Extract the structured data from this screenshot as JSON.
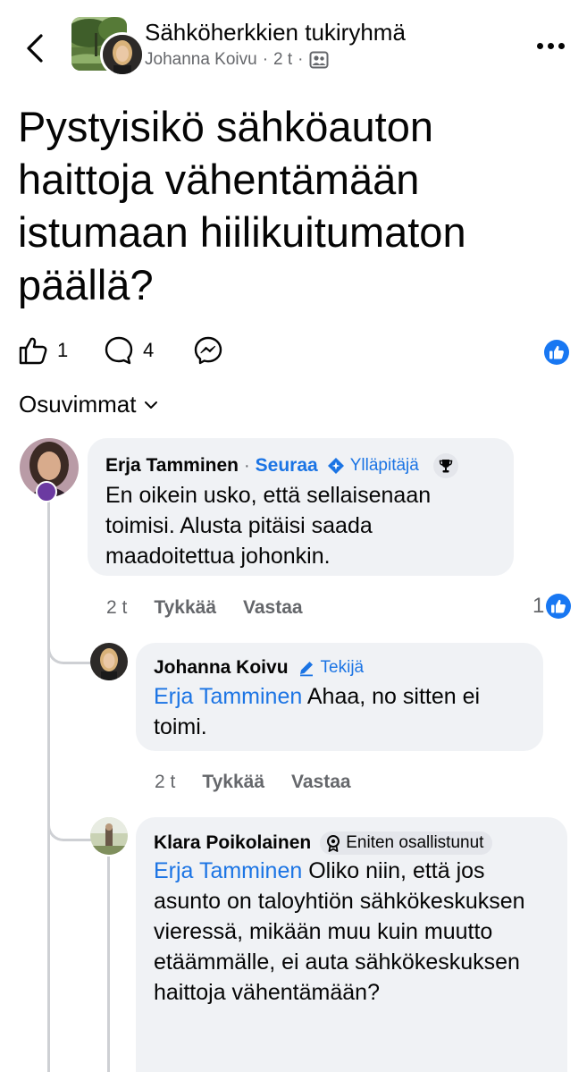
{
  "header": {
    "group_name": "Sähköherkkien tukiryhmä",
    "author": "Johanna Koivu",
    "separator": "·",
    "time": "2 t",
    "audience_icon": "members-icon",
    "back_icon": "chevron-left-icon",
    "more_icon": "more-dots-icon"
  },
  "post": {
    "title": "Pystyisikö sähköauton haittoja vähentämään istumaan hiilikuitumaton päällä?"
  },
  "actions": {
    "like_count": "1",
    "comment_count": "4",
    "share_icon": "messenger-icon",
    "like_badge_icon": "thumbs-up-icon"
  },
  "sort": {
    "label": "Osuvimmat"
  },
  "comments": [
    {
      "name": "Erja Tamminen",
      "separator": "·",
      "follow": "Seuraa",
      "role": "Ylläpitäjä",
      "text": "En oikein usko, että sellaisenaan toimisi. Alusta pitäisi saada maadoitettua johonkin.",
      "time": "2 t",
      "like_label": "Tykkää",
      "reply_label": "Vastaa",
      "reactions": "1"
    },
    {
      "name": "Johanna Koivu",
      "role": "Tekijä",
      "mention": "Erja Tamminen",
      "text": "Ahaa, no sitten ei toimi.",
      "time": "2 t",
      "like_label": "Tykkää",
      "reply_label": "Vastaa"
    },
    {
      "name": "Klara Poikolainen",
      "badge": "Eniten osallistunut",
      "mention": "Erja Tamminen",
      "text": "Oliko niin, että jos asunto on taloyhtiön sähkökeskuksen vieressä, mikään muu kuin muutto etäämmälle, ei auta sähkökeskuksen haittoja vähentämään?"
    }
  ],
  "colors": {
    "accent": "#1877f2",
    "link": "#1b74e4",
    "bubble": "#f0f2f5",
    "secondary_text": "#65676b"
  }
}
